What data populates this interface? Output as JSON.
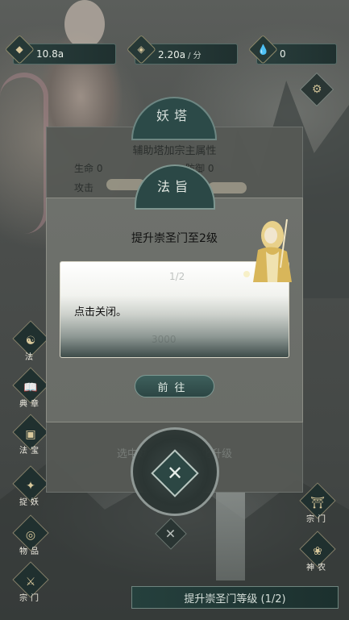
{
  "resources": [
    {
      "icon": "gold-coin-icon",
      "value": "10.8a",
      "unit": ""
    },
    {
      "icon": "income-icon",
      "value": "2.20a",
      "unit": "/ 分"
    },
    {
      "icon": "water-drop-icon",
      "value": "0",
      "unit": ""
    }
  ],
  "back_panel": {
    "title": "妖塔",
    "subtitle": "辅助塔加宗主属性",
    "stat_life": "生命",
    "stat_life_value": "0",
    "stat_def": "防御",
    "stat_def_value": "0",
    "stat_atk": "攻击",
    "progress_label": "1/2",
    "cost": "3000",
    "hint": "选中妖灵可进行魔化升级"
  },
  "dialog": {
    "title": "法旨",
    "message": "提升崇圣门至2级",
    "tip": "点击关闭。",
    "goto_label": "前往",
    "close_label": "✕"
  },
  "left_menu": [
    {
      "icon": "dharma-icon",
      "label": "法"
    },
    {
      "icon": "book-icon",
      "label": "典章"
    },
    {
      "icon": "chest-icon",
      "label": "法宝"
    },
    {
      "icon": "demon-icon",
      "label": "捉妖"
    },
    {
      "icon": "bag-icon",
      "label": "物品"
    },
    {
      "icon": "sword-icon",
      "label": "宗门"
    }
  ],
  "right_menu": [
    {
      "icon": "gate-icon",
      "label": "宗门"
    },
    {
      "icon": "bonsai-icon",
      "label": "神农"
    }
  ],
  "upgrade_button": "提升崇圣门等级 (1/2)"
}
